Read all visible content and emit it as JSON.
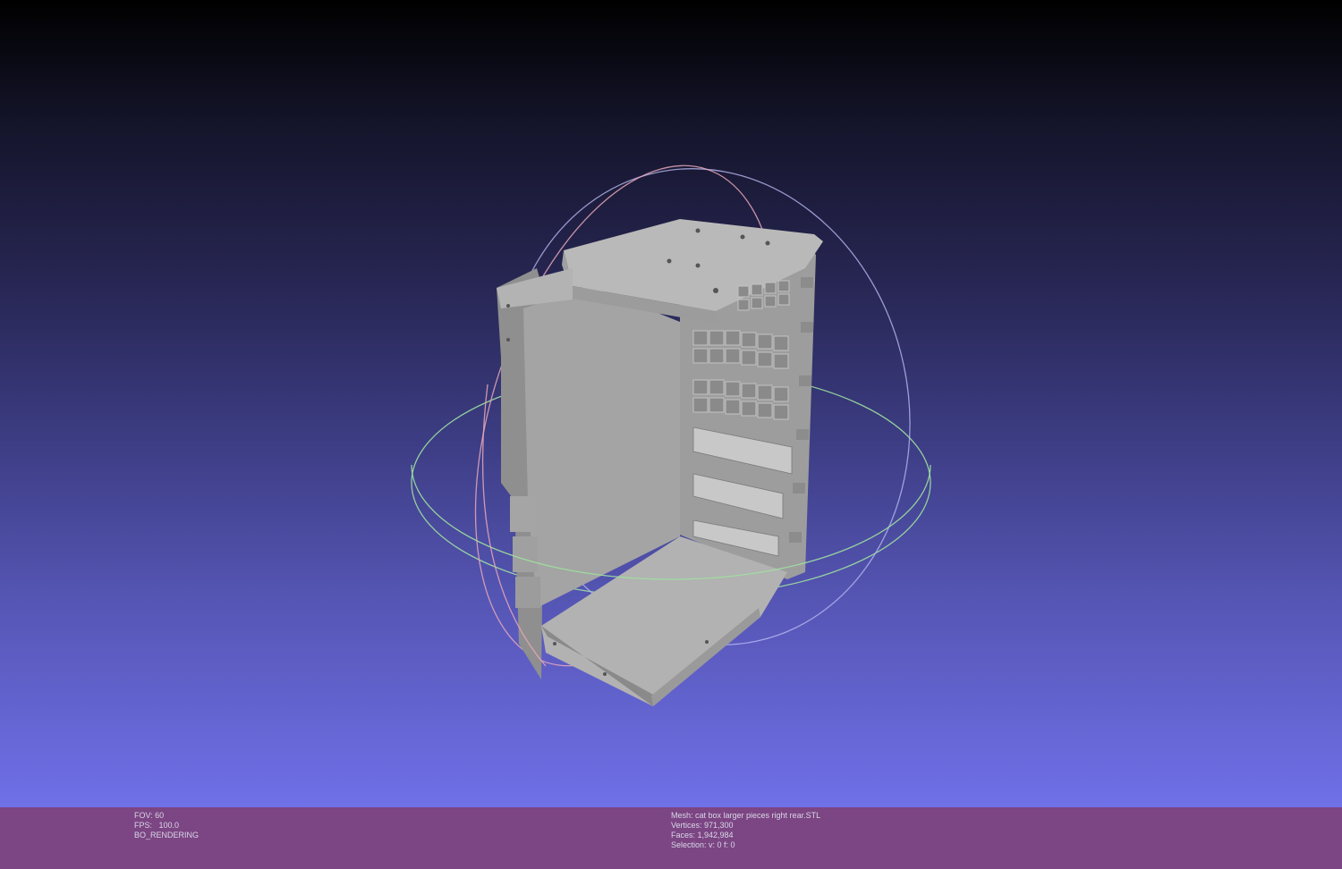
{
  "viewport": {
    "background_top": "#000000",
    "background_bottom": "#7070e8",
    "mesh_color": "#a9a9a9",
    "trackball": {
      "x_ring_color": "#e8a0a0",
      "y_ring_color": "#a0e8a0",
      "z_ring_color": "#a0a0e8"
    }
  },
  "status_bar": {
    "background": "#7c4583",
    "left": {
      "fov": "FOV: 60",
      "fps": "FPS:   100.0",
      "mode": "BO_RENDERING"
    },
    "right": {
      "mesh": "Mesh: cat box larger pieces right rear.STL",
      "vertices": "Vertices: 971,300",
      "faces": "Faces: 1,942,984",
      "selection": "Selection: v: 0 f: 0"
    }
  }
}
